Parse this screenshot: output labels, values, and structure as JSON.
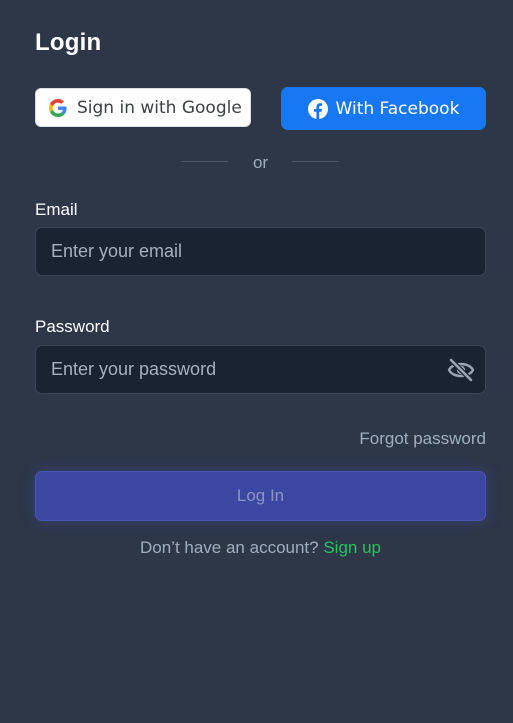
{
  "page": {
    "title": "Login"
  },
  "social": {
    "google_label": "Sign in with Google",
    "facebook_label": "With Facebook"
  },
  "divider": {
    "text": "or"
  },
  "email": {
    "label": "Email",
    "placeholder": "Enter your email",
    "value": ""
  },
  "password": {
    "label": "Password",
    "placeholder": "Enter your password",
    "value": "",
    "toggle_icon": "eye-off-icon"
  },
  "forgot_password": {
    "label": "Forgot password"
  },
  "login_button": {
    "label": "Log In"
  },
  "signup": {
    "prompt": "Don’t have an account?",
    "link_label": "Sign up"
  },
  "colors": {
    "background": "#2d3748",
    "input_background": "#1a2332",
    "facebook_blue": "#1877f2",
    "login_button": "#3b47a0",
    "signup_link": "#22c55e",
    "muted_text": "#a0aec0"
  }
}
